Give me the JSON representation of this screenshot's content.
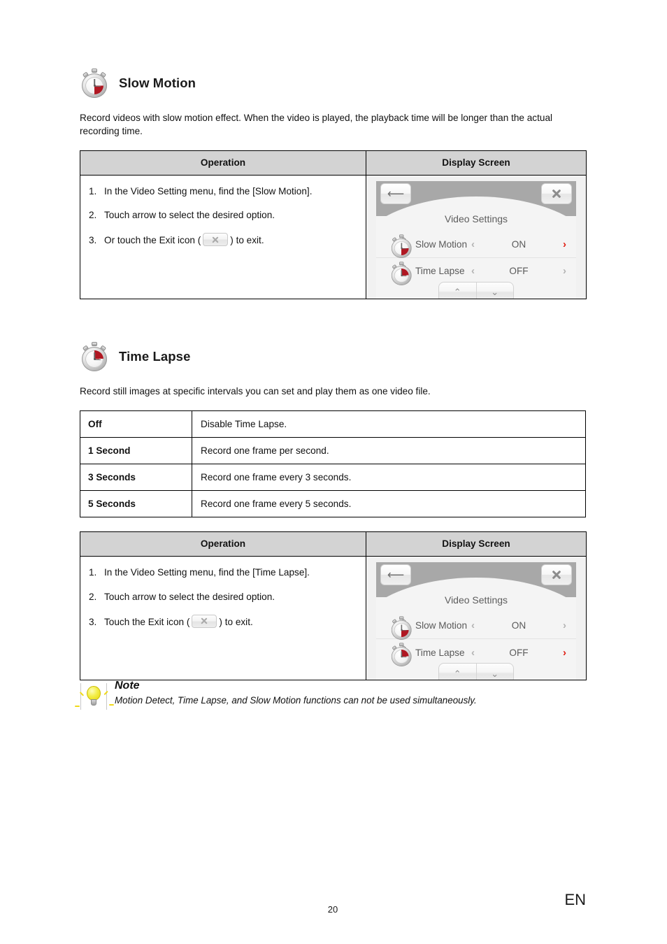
{
  "sections": [
    {
      "id": "slow-motion",
      "icon": "stopwatch-icon",
      "title": "Slow Motion",
      "description": "Record videos with slow motion effect. When the video is played, the playback time will be longer than the actual recording time.",
      "table": {
        "headers": {
          "operation": "Operation",
          "display": "Display Screen"
        },
        "steps": [
          {
            "num": "1.",
            "text_before": "In the Video Setting menu, find the [Slow Motion].",
            "text_after": ""
          },
          {
            "num": "2.",
            "text_before": "Touch arrow to select the desired option.",
            "text_after": ""
          },
          {
            "num": "3.",
            "text_before": "Or touch the Exit icon (",
            "text_after": ") to exit."
          }
        ]
      },
      "screen": {
        "back_icon": "back-arrow-icon",
        "exit_icon": "close-icon",
        "title": "Video Settings",
        "rows": [
          {
            "icon": "stopwatch-icon",
            "label": "Slow Motion",
            "left_arrow": "‹",
            "value": "ON",
            "right_arrow": "›",
            "right_active": true
          },
          {
            "icon": "stopwatch-icon",
            "label": "Time Lapse",
            "left_arrow": "‹",
            "value": "OFF",
            "right_arrow": "›",
            "right_active": false
          }
        ],
        "pager": {
          "up": "⌃",
          "down": "⌄"
        }
      }
    },
    {
      "id": "time-lapse",
      "icon": "stopwatch-icon",
      "title": "Time Lapse",
      "description": "Record still images at specific intervals you can set and play them as one video file.",
      "options": [
        {
          "key": "Off",
          "value": "Disable Time Lapse."
        },
        {
          "key": "1 Second",
          "value": "Record one frame per second."
        },
        {
          "key": "3 Seconds",
          "value": "Record one frame every 3 seconds."
        },
        {
          "key": "5 Seconds",
          "value": "Record one frame every 5 seconds."
        }
      ],
      "table": {
        "headers": {
          "operation": "Operation",
          "display": "Display Screen"
        },
        "steps": [
          {
            "num": "1.",
            "text_before": "In the Video Setting menu, find the [Time Lapse].",
            "text_after": ""
          },
          {
            "num": "2.",
            "text_before": "Touch arrow to select the desired option.",
            "text_after": ""
          },
          {
            "num": "3.",
            "text_before": "Touch the Exit icon (",
            "text_after": ") to exit."
          }
        ]
      },
      "screen": {
        "back_icon": "back-arrow-icon",
        "exit_icon": "close-icon",
        "title": "Video Settings",
        "rows": [
          {
            "icon": "stopwatch-icon",
            "label": "Slow Motion",
            "left_arrow": "‹",
            "value": "ON",
            "right_arrow": "›",
            "right_active": false
          },
          {
            "icon": "stopwatch-icon",
            "label": "Time Lapse",
            "left_arrow": "‹",
            "value": "OFF",
            "right_arrow": "›",
            "right_active": true
          }
        ],
        "pager": {
          "up": "⌃",
          "down": "⌄"
        }
      }
    }
  ],
  "note": {
    "icon": "lightbulb-icon",
    "title": "Note",
    "text": "Motion Detect, Time Lapse, and Slow Motion functions can not be used simultaneously."
  },
  "footer": {
    "page_number": "20",
    "language": "EN"
  },
  "colors": {
    "accent_red": "#e01b10",
    "icon_red": "#b01722",
    "header_grey": "#d3d3d3",
    "screen_bar_grey": "#a8a8a8",
    "bulb_yellow": "#f3ee48"
  }
}
